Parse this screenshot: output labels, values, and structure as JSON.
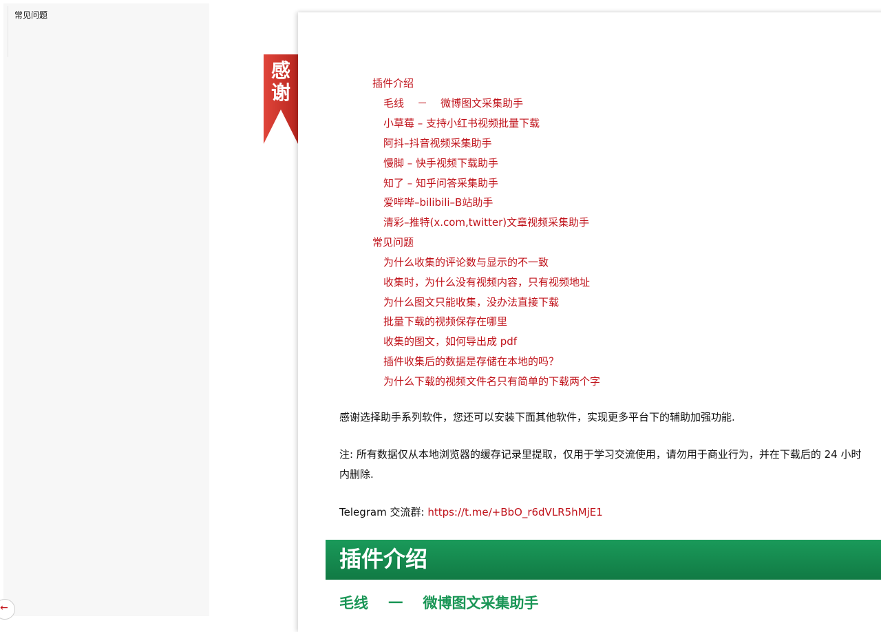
{
  "sidebar": {
    "items": [
      {
        "label": "常见问题"
      }
    ],
    "back_icon_glyph": "←"
  },
  "ribbon": {
    "text": "感谢",
    "color": "#d2342c"
  },
  "toc": {
    "sections": [
      {
        "title": "插件介绍",
        "items": [
          "毛线    －    微博图文采集助手",
          "小草莓 – 支持小红书视频批量下载",
          "阿抖–抖音视频采集助手",
          "慢脚 – 快手视频下载助手",
          "知了 – 知乎问答采集助手",
          "爱哔哔–bilibili–B站助手",
          "清彩–推特(x.com,twitter)文章视频采集助手"
        ]
      },
      {
        "title": "常见问题",
        "items": [
          "为什么收集的评论数与显示的不一致",
          "收集时，为什么没有视频内容，只有视频地址",
          "为什么图文只能收集，没办法直接下载",
          "批量下载的视频保存在哪里",
          "收集的图文，如何导出成 pdf",
          "插件收集后的数据是存储在本地的吗？",
          "为什么下载的视频文件名只有简单的下载两个字"
        ]
      }
    ]
  },
  "content": {
    "intro": "感谢选择助手系列软件，您还可以安装下面其他软件，实现更多平台下的辅助加强功能.",
    "note": "注: 所有数据仅从本地浏览器的缓存记录里提取，仅用于学习交流使用，请勿用于商业行为，并在下载后的 24 小时内删除.",
    "telegram_label": "Telegram 交流群: ",
    "telegram_link": "https://t.me/+BbO_r6dVLR5hMjE1",
    "section_title": "插件介绍",
    "sub_heading": "毛线    一    微博图文采集助手"
  },
  "colors": {
    "link_red": "#c0121a",
    "header_green": "#17904f",
    "subheading_green": "#1a9656",
    "sidebar_bg": "#f7f7f7"
  }
}
